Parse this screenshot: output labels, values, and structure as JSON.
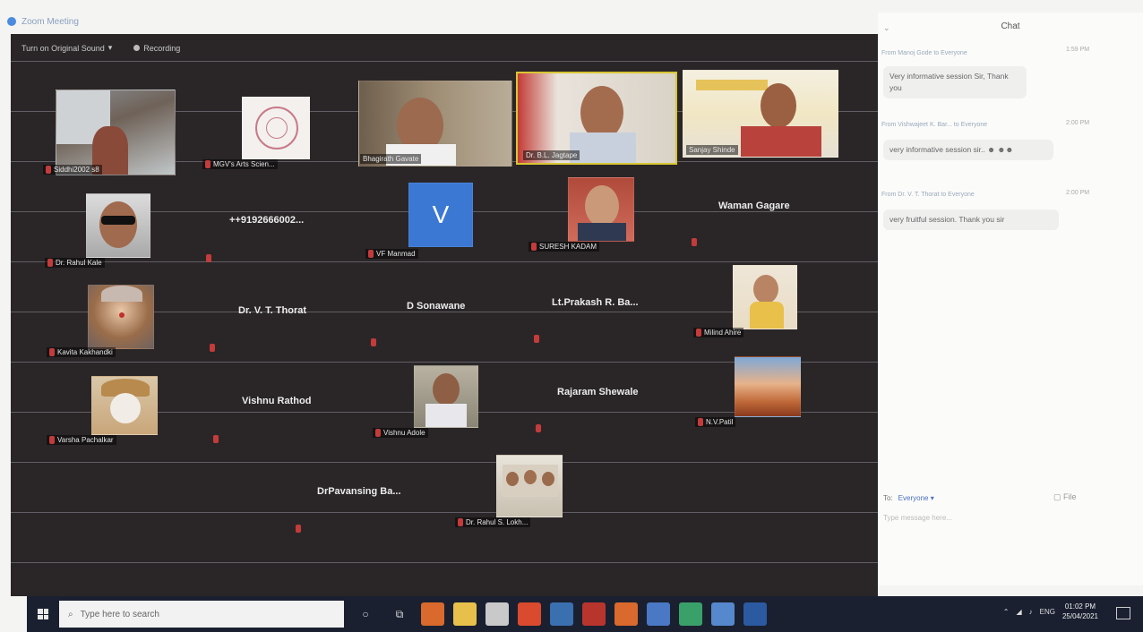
{
  "window": {
    "title": "Zoom Meeting"
  },
  "meeting_toolbar": {
    "original_sound": "Turn on Original Sound",
    "recording": "Recording"
  },
  "participants": {
    "p1": "Siddhi2002 s8",
    "p2": "MGV's Arts Scien...",
    "p3": "Bhagirath Gavate",
    "p4": "Dr. B.L. Jagtape",
    "p5": "Sanjay Shinde",
    "p6": "Dr. Rahul Kale",
    "p7": "++9192666002...",
    "p8": "VF Manmad",
    "p9": "SURESH KADAM",
    "p10": "Waman Gagare",
    "p11": "Kavita Kakhandki",
    "p12": "Dr. V. T. Thorat",
    "p13": "D Sonawane",
    "p14": "Lt.Prakash R. Ba...",
    "p15": "Milind Ahire",
    "p16": "Varsha Pachalkar",
    "p17": "Vishnu Rathod",
    "p18": "Vishnu Adole",
    "p19": "Rajaram Shewale",
    "p20": "N.V.Patil",
    "p21": "DrPavansing Ba...",
    "p22": "Dr. Rahul S. Lokh..."
  },
  "avatar_letter": "V",
  "chat": {
    "title": "Chat",
    "messages": [
      {
        "meta": "From Manoj Gode to Everyone",
        "time": "1:59 PM",
        "text": "Very informative session Sir, Thank you"
      },
      {
        "meta": "From Vishwajeet K. Bar... to Everyone",
        "time": "2:00 PM",
        "text": "very informative session sir.. ☻ ☻☻"
      },
      {
        "meta": "From Dr. V. T. Thorat to Everyone",
        "time": "2:00 PM",
        "text": "very fruitful session. Thank you sir"
      }
    ],
    "to_label": "To:",
    "to_value": "Everyone ▾",
    "file_label": "File",
    "input_placeholder": "Type message here..."
  },
  "taskbar": {
    "search_placeholder": "Type here to search",
    "tray_lang": "ENG",
    "time": "01:02 PM",
    "date": "25/04/2021"
  },
  "colors": {
    "meeting_bg": "#2a2627",
    "active_speaker": "#d8c634",
    "taskbar_bg": "#1a2030",
    "avatar_blue": "#3b78d4"
  }
}
